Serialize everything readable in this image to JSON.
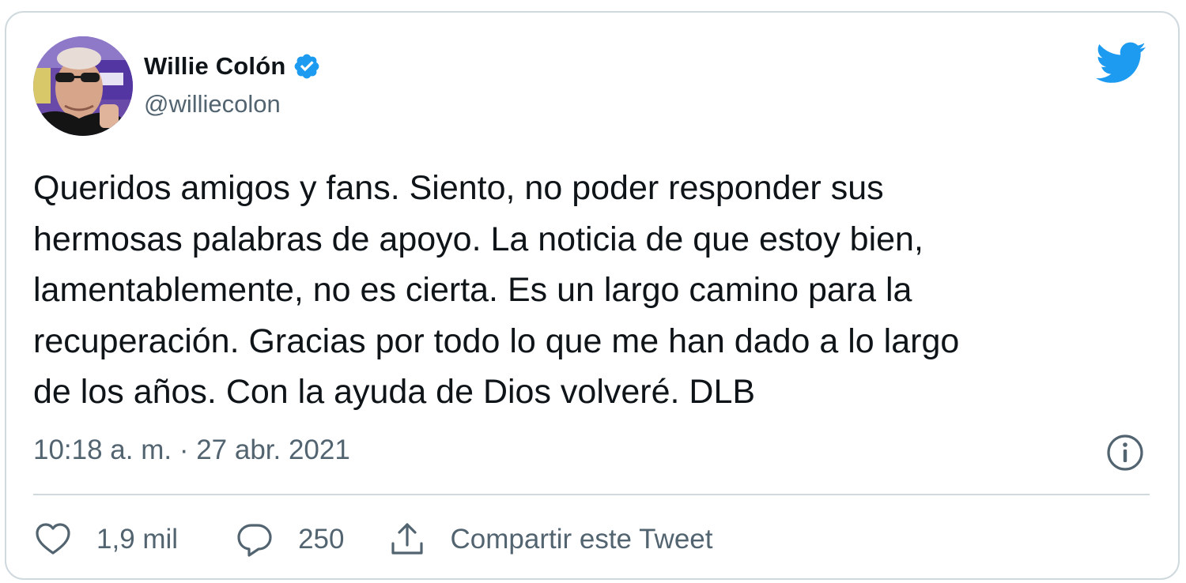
{
  "user": {
    "display_name": "Willie Colón",
    "handle": "@williecolon",
    "verified": true,
    "avatar_icon": "profile-photo"
  },
  "tweet": {
    "text": "Queridos amigos y fans. Siento, no poder responder sus\nhermosas palabras de apoyo. La noticia de que estoy bien,\nlamentablemente, no es cierta. Es un largo camino para la\nrecuperación. Gracias por todo lo que me han dado a lo largo\nde los años. Con la ayuda de Dios volveré. DLB",
    "timestamp": "10:18 a. m. · 27 abr. 2021"
  },
  "actions": {
    "like_count": "1,9 mil",
    "reply_count": "250",
    "share_label": "Compartir este Tweet"
  },
  "icons": {
    "brand": "twitter-bird-icon",
    "verified": "verified-badge-icon",
    "info": "info-icon",
    "like": "heart-icon",
    "reply": "speech-bubble-icon",
    "share": "share-upload-icon"
  },
  "colors": {
    "twitter_blue": "#1d9bf0",
    "text_primary": "#0f1419",
    "text_secondary": "#536471",
    "border": "#cfd9de"
  }
}
